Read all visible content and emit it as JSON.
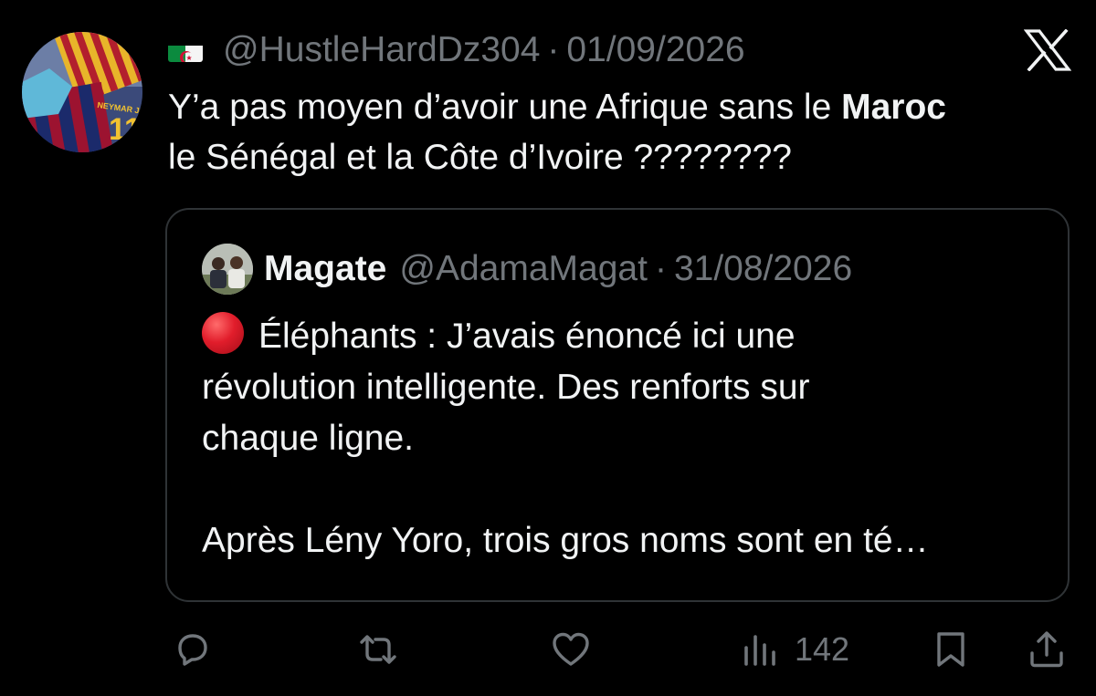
{
  "tweet": {
    "handle": "@HustleHardDz304",
    "separator": "·",
    "date": "01/09/2026",
    "flag_icon": "algeria-flag-icon",
    "text_part1": "Y’a pas moyen d’avoir une Afrique sans le ",
    "text_bold": "Maroc",
    "text_part2": "le Sénégal et la Côte d’Ivoire ????????"
  },
  "quote": {
    "name": "Magate",
    "handle": "@AdamaMagat",
    "separator": "·",
    "date": "31/08/2026",
    "icon": "red-circle-icon",
    "line1": "Éléphants : J’avais énoncé ici une",
    "line2": "révolution intelligente. Des renforts sur",
    "line3": "chaque ligne.",
    "line4": "Après Lény Yoro, trois gros noms sont en  té…"
  },
  "actions": {
    "views_count": "142",
    "icons": [
      "reply-icon",
      "retweet-icon",
      "like-icon",
      "views-icon",
      "bookmark-icon",
      "share-icon"
    ]
  },
  "colors": {
    "background": "#000000",
    "text_primary": "#f1f3f4",
    "text_secondary": "#71767b",
    "border": "#2f3336",
    "accent_red": "#e11d2b"
  }
}
